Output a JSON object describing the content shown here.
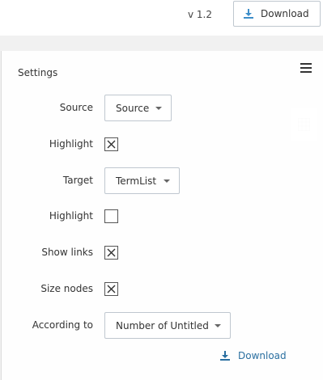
{
  "header": {
    "version": "v 1.2",
    "download_label": "Download"
  },
  "settings": {
    "title": "Settings",
    "rows": {
      "source_label": "Source",
      "source_value": "Source",
      "highlight1_label": "Highlight",
      "highlight1_checked": true,
      "target_label": "Target",
      "target_value": "TermList",
      "highlight2_label": "Highlight",
      "highlight2_checked": false,
      "show_links_label": "Show links",
      "show_links_checked": true,
      "size_nodes_label": "Size nodes",
      "size_nodes_checked": true,
      "according_to_label": "According to",
      "according_to_value": "Number of Untitled"
    },
    "download_label": "Download"
  },
  "colors": {
    "accent": "#2a6fa0",
    "download_icon": "#3d8ec9",
    "background": "#f1f1f1"
  }
}
